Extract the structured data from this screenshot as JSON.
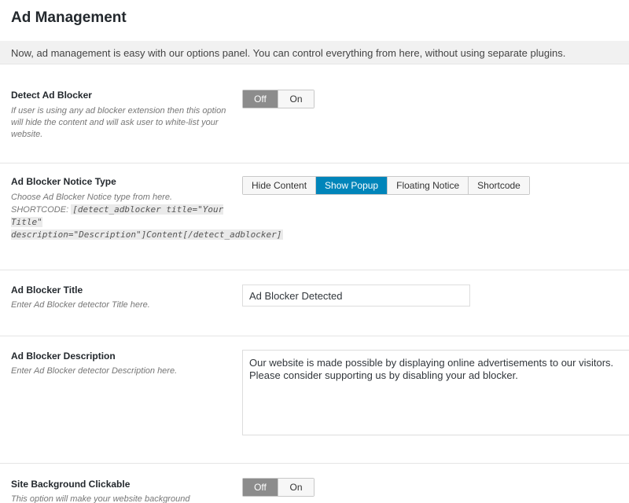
{
  "header": {
    "title": "Ad Management",
    "intro": "Now, ad management is easy with our options panel. You can control everything from here, without using separate plugins."
  },
  "detect_ad_blocker": {
    "label": "Detect Ad Blocker",
    "description": "If user is using any ad blocker extension then this option will hide the content and will ask user to white-list your website.",
    "options": [
      "Off",
      "On"
    ],
    "selected": "Off"
  },
  "notice_type": {
    "label": "Ad Blocker Notice Type",
    "description": "Choose Ad Blocker Notice type from here.",
    "shortcode_label": "SHORTCODE:",
    "shortcode": "[detect_adblocker title=\"Your Title\" description=\"Description\"]Content[/detect_adblocker]",
    "options": [
      "Hide Content",
      "Show Popup",
      "Floating Notice",
      "Shortcode"
    ],
    "selected": "Show Popup"
  },
  "ad_blocker_title": {
    "label": "Ad Blocker Title",
    "description": "Enter Ad Blocker detector Title here.",
    "value": "Ad Blocker Detected"
  },
  "ad_blocker_description": {
    "label": "Ad Blocker Description",
    "description": "Enter Ad Blocker detector Description here.",
    "value": "Our website is made possible by displaying online advertisements to our visitors. Please consider supporting us by disabling your ad blocker."
  },
  "site_background_clickable": {
    "label": "Site Background Clickable",
    "description": "This option will make your website background",
    "options": [
      "Off",
      "On"
    ],
    "selected": "Off"
  }
}
